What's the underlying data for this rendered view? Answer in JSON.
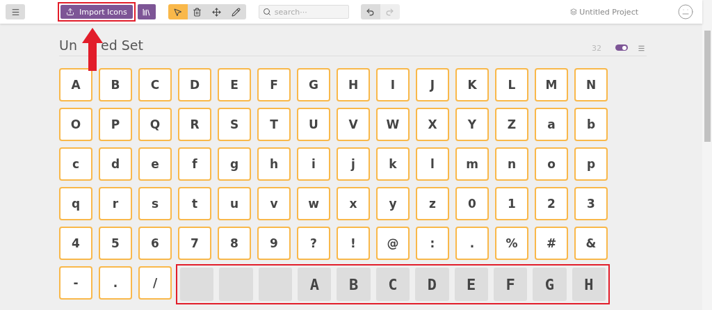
{
  "toolbar": {
    "import_button": {
      "label": "Import Icons",
      "highlighted": true
    },
    "tools": [
      {
        "kind": "select",
        "selected": true
      },
      {
        "kind": "delete",
        "selected": false
      },
      {
        "kind": "move",
        "selected": false
      },
      {
        "kind": "edit",
        "selected": false
      }
    ],
    "search": {
      "placeholder": "search···"
    },
    "history": [
      {
        "kind": "undo",
        "disabled": false
      },
      {
        "kind": "redo",
        "disabled": true
      }
    ],
    "project": "Untitled Project"
  },
  "set": {
    "title_parts": [
      "Un",
      "ed Set"
    ],
    "count": "32",
    "toggle_on": true,
    "glyphs": [
      "A",
      "B",
      "C",
      "D",
      "E",
      "F",
      "G",
      "H",
      "I",
      "J",
      "K",
      "L",
      "M",
      "N",
      "O",
      "P",
      "Q",
      "R",
      "S",
      "T",
      "U",
      "V",
      "W",
      "X",
      "Y",
      "Z",
      "a",
      "b",
      "c",
      "d",
      "e",
      "f",
      "g",
      "h",
      "i",
      "j",
      "k",
      "l",
      "m",
      "n",
      "o",
      "p",
      "q",
      "r",
      "s",
      "t",
      "u",
      "v",
      "w",
      "x",
      "y",
      "z",
      "0",
      "1",
      "2",
      "3",
      "4",
      "5",
      "6",
      "7",
      "8",
      "9",
      "?",
      "!",
      "@",
      ":",
      ".",
      "%",
      "#",
      "&",
      "-",
      ".",
      "/"
    ],
    "pixel_set": {
      "highlighted": true,
      "cells": [
        {
          "kind": "empty"
        },
        {
          "kind": "empty"
        },
        {
          "kind": "empty"
        },
        {
          "kind": "glyph",
          "char": "A"
        },
        {
          "kind": "glyph",
          "char": "B"
        },
        {
          "kind": "glyph",
          "char": "C"
        },
        {
          "kind": "glyph",
          "char": "D"
        },
        {
          "kind": "glyph",
          "char": "E"
        },
        {
          "kind": "glyph",
          "char": "F"
        },
        {
          "kind": "glyph",
          "char": "G"
        },
        {
          "kind": "glyph",
          "char": "H"
        }
      ]
    }
  }
}
